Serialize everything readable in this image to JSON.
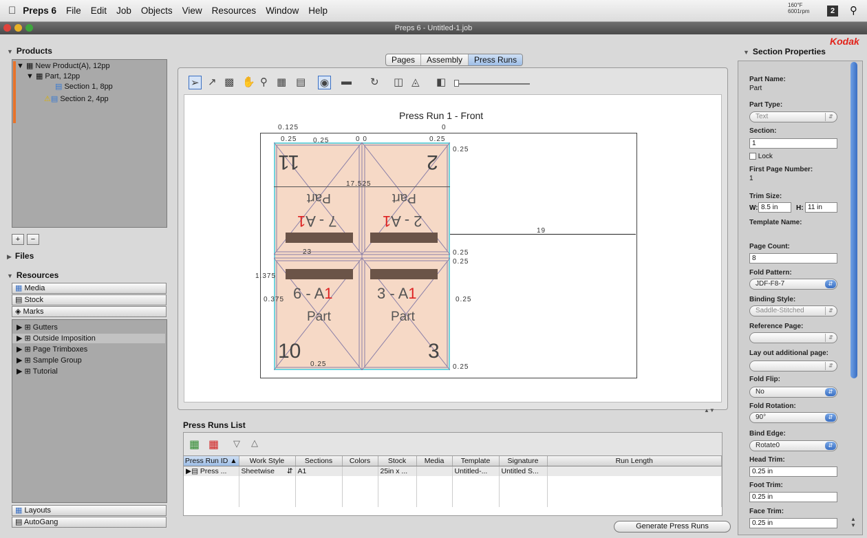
{
  "menubar": {
    "app": "Preps 6",
    "items": [
      "File",
      "Edit",
      "Job",
      "Objects",
      "View",
      "Resources",
      "Window",
      "Help"
    ],
    "temp": "160°F",
    "rpm": "6001rpm",
    "badge": "2"
  },
  "window": {
    "title": "Preps 6 - Untitled-1.job"
  },
  "left": {
    "products_label": "Products",
    "tree": [
      {
        "label": "New Product(A), 12pp"
      },
      {
        "label": "Part, 12pp"
      },
      {
        "label": "Section 1, 8pp"
      },
      {
        "label": "Section 2, 4pp"
      }
    ],
    "add": "+",
    "remove": "−",
    "files_label": "Files",
    "resources_label": "Resources",
    "resources": [
      "Media",
      "Stock",
      "Marks"
    ],
    "marks": [
      "Gutters",
      "Outside Imposition",
      "Page Trimboxes",
      "Sample Group",
      "Tutorial"
    ],
    "bottom": [
      "Layouts",
      "AutoGang"
    ]
  },
  "tabs": [
    "Pages",
    "Assembly",
    "Press Runs"
  ],
  "canvas": {
    "title": "Press Run 1 - Front",
    "dims": {
      "top_left": "0.125",
      "top_zero": "0",
      "d025a": "0.25",
      "d025b": "0.25",
      "d00": "0  0",
      "d025c": "0.25",
      "right1": "0.25",
      "width": "17.525",
      "mid": "19",
      "mid_r1": "0.25",
      "mid_r2": "0.25",
      "left1375": "1.375",
      "left0375": "0.375",
      "gut": "0.25",
      "bottom_r": "0.25",
      "bottom_c": "0.25",
      "side_23": "23"
    },
    "pages": [
      {
        "num": "11",
        "sig": "7 - A1",
        "name": "Part"
      },
      {
        "num": "2",
        "sig": "2 - A1",
        "name": "Part"
      },
      {
        "num": "10",
        "sig": "6 - A1",
        "name": "Part"
      },
      {
        "num": "3",
        "sig": "3 - A1",
        "name": "Part"
      }
    ]
  },
  "runs": {
    "label": "Press Runs List",
    "columns": [
      "Press Run ID",
      "Work Style",
      "Sections",
      "Colors",
      "Stock",
      "Media",
      "Template",
      "Signature",
      "Run Length"
    ],
    "rows": [
      [
        "Press ...",
        "Sheetwise",
        "A1",
        "",
        "25in x ...",
        "",
        "Untitled-...",
        "Untitled S...",
        ""
      ]
    ],
    "generate": "Generate Press Runs"
  },
  "right": {
    "brand": "Kodak",
    "title": "Section Properties",
    "part_name_label": "Part Name:",
    "part_name": "Part",
    "part_type_label": "Part Type:",
    "part_type": "Text",
    "section_label": "Section:",
    "section": "1",
    "lock": "Lock",
    "first_page_label": "First Page Number:",
    "first_page": "1",
    "trim_label": "Trim Size:",
    "w_label": "W:",
    "w": "8.5 in",
    "h_label": "H:",
    "h": "11 in",
    "template_label": "Template Name:",
    "page_count_label": "Page Count:",
    "page_count": "8",
    "fold_pattern_label": "Fold Pattern:",
    "fold_pattern": "JDF-F8-7",
    "binding_label": "Binding Style:",
    "binding": "Saddle-Stitched",
    "ref_label": "Reference Page:",
    "ref": "",
    "layout_label": "Lay out additional page:",
    "layout": "",
    "fold_flip_label": "Fold Flip:",
    "fold_flip": "No",
    "fold_rot_label": "Fold Rotation:",
    "fold_rot": "90°",
    "bind_edge_label": "Bind Edge:",
    "bind_edge": "Rotate0",
    "head_trim_label": "Head Trim:",
    "head_trim": "0.25 in",
    "foot_trim_label": "Foot Trim:",
    "foot_trim": "0.25 in",
    "face_trim_label": "Face Trim:",
    "face_trim": "0.25 in"
  }
}
